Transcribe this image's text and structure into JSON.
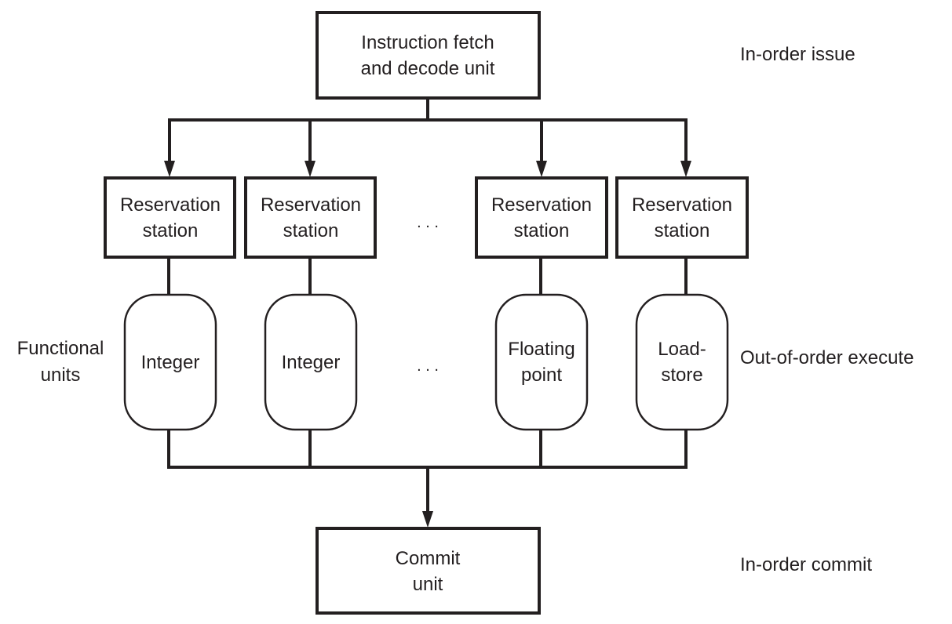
{
  "fetch_unit": {
    "line1": "Instruction fetch",
    "line2": "and decode unit"
  },
  "reservation_stations": [
    {
      "line1": "Reservation",
      "line2": "station"
    },
    {
      "line1": "Reservation",
      "line2": "station"
    },
    {
      "line1": "Reservation",
      "line2": "station"
    },
    {
      "line1": "Reservation",
      "line2": "station"
    }
  ],
  "functional_units": [
    {
      "line1": "Integer",
      "line2": ""
    },
    {
      "line1": "Integer",
      "line2": ""
    },
    {
      "line1": "Floating",
      "line2": "point"
    },
    {
      "line1": "Load-",
      "line2": "store"
    }
  ],
  "ellipsis": ". . .",
  "commit_unit": {
    "line1": "Commit",
    "line2": "unit"
  },
  "labels": {
    "functional_units_line1": "Functional",
    "functional_units_line2": "units",
    "in_order_issue": "In-order issue",
    "out_of_order_execute": "Out-of-order execute",
    "in_order_commit": "In-order commit"
  }
}
